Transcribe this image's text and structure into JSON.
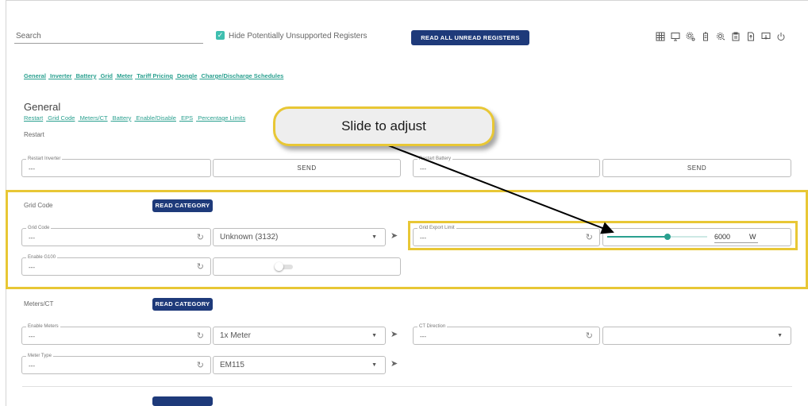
{
  "toolbar": {
    "search_placeholder": "Search",
    "hide_unsupported_label": "Hide Potentially Unsupported Registers",
    "hide_unsupported_checked": true,
    "read_all_label": "READ ALL UNREAD REGISTERS",
    "icons": [
      "grid-icon",
      "monitor-icon",
      "gear-network-icon",
      "battery-icon",
      "gear-refresh-icon",
      "clipboard-icon",
      "export-file-icon",
      "screen-download-icon",
      "power-icon"
    ]
  },
  "categories": [
    "General",
    "Inverter",
    "Battery",
    "Grid",
    "Meter",
    "Tariff Pricing",
    "Dongle",
    "Charge/Discharge Schedules"
  ],
  "general": {
    "title": "General",
    "sublinks": [
      "Restart",
      "Grid Code",
      "Meters/CT",
      "Battery",
      "Enable/Disable",
      "EPS",
      "Percentage Limits"
    ],
    "restart_label": "Restart",
    "restart_inverter": {
      "label": "Restart Inverter",
      "value": "---",
      "send": "SEND"
    },
    "restart_battery": {
      "label": "Restart Battery",
      "value": "---",
      "send": "SEND"
    }
  },
  "grid_code": {
    "title": "Grid Code",
    "read_category": "READ CATEGORY",
    "grid_code": {
      "label": "Grid Code",
      "value": "---",
      "selected": "Unknown (3132)"
    },
    "enable_g100": {
      "label": "Enable G100",
      "value": "---",
      "toggle_on": false
    },
    "grid_export_limit": {
      "label": "Grid Export Limit",
      "value": "---",
      "slider_fraction": 0.6,
      "amount": "6000",
      "unit": "W"
    }
  },
  "meters": {
    "title": "Meters/CT",
    "read_category": "READ CATEGORY",
    "enable_meters": {
      "label": "Enable Meters",
      "value": "---",
      "selected": "1x Meter"
    },
    "ct_direction": {
      "label": "CT Direction",
      "value": "---",
      "selected": ""
    },
    "meter_type": {
      "label": "Meter Type",
      "value": "---",
      "selected": "EM115"
    }
  },
  "callout": {
    "text": "Slide to adjust"
  },
  "colors": {
    "accent": "#2aa08f",
    "navy": "#1e3a7a",
    "highlight": "#e8c735",
    "checkbox": "#3fbfb0"
  }
}
